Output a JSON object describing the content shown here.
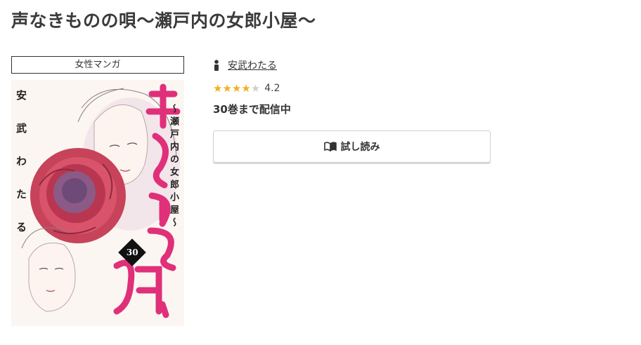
{
  "page": {
    "title": "声なきものの唄〜瀬戸内の女郎小屋〜"
  },
  "book": {
    "genre": "女性マンガ",
    "cover": {
      "title_text": "声なきものの唄",
      "author_text": "安武わたる",
      "subtitle_text": "〜瀬戸内の女郎小屋〜",
      "volume_text": "30",
      "accent_color": "#e0307a"
    },
    "author_icon": "person-icon",
    "author": "安武わたる",
    "rating": {
      "value": 4.2,
      "max": 5,
      "label": "4.2",
      "star_color": "#f2b01e"
    },
    "status": "30巻まで配信中",
    "trial_button": {
      "label": "試し読み",
      "icon": "open-book-icon"
    }
  }
}
